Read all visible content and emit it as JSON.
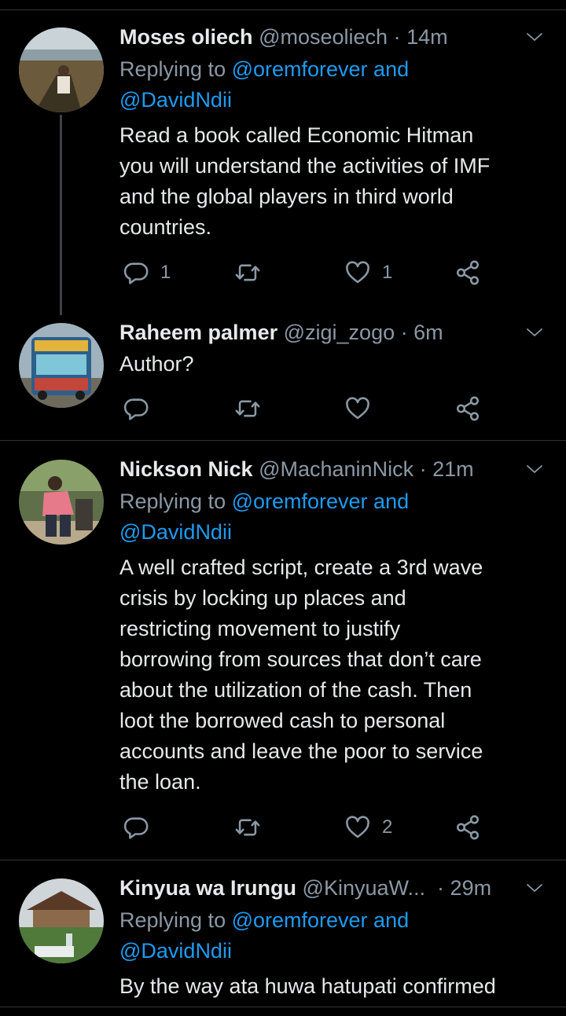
{
  "replying_prefix": "Replying to ",
  "tweets": [
    {
      "name": "Moses oliech",
      "handle": "@moseoliech",
      "time": "14m",
      "reply_mentions": [
        "@oremforever and",
        "@DavidNdii"
      ],
      "text": [
        "Read a book called Economic Hitman",
        "you will understand the activities of IMF",
        "and the global players in third world",
        "countries."
      ],
      "replies": "1",
      "retweets": "",
      "likes": "1"
    },
    {
      "name": "Raheem palmer",
      "handle": "@zigi_zogo",
      "time": "6m",
      "text": [
        "Author?"
      ],
      "replies": "",
      "retweets": "",
      "likes": ""
    },
    {
      "name": "Nickson Nick",
      "handle": "@MachaninNick",
      "time": "21m",
      "reply_mentions": [
        "@oremforever and",
        "@DavidNdii"
      ],
      "text": [
        "A well crafted script, create a 3rd wave",
        "crisis by locking up places and",
        "restricting movement to justify",
        "borrowing from sources that don’t care",
        "about the utilization of the cash. Then",
        "loot the borrowed cash to personal",
        "accounts and leave the poor to service",
        "the loan."
      ],
      "replies": "",
      "retweets": "",
      "likes": "2"
    },
    {
      "name": "Kinyua wa Irungu",
      "handle": "@KinyuaW...",
      "time": "29m",
      "reply_mentions": [
        "@oremforever and",
        "@DavidNdii"
      ],
      "text": [
        "By the way ata huwa hatupati confirmed"
      ]
    }
  ],
  "colors": {
    "mention": "#1d9bf0",
    "muted": "#8b98a5",
    "background": "#000000"
  },
  "icons": [
    "reply-icon",
    "retweet-icon",
    "like-icon",
    "share-icon",
    "chevron-down-icon"
  ]
}
